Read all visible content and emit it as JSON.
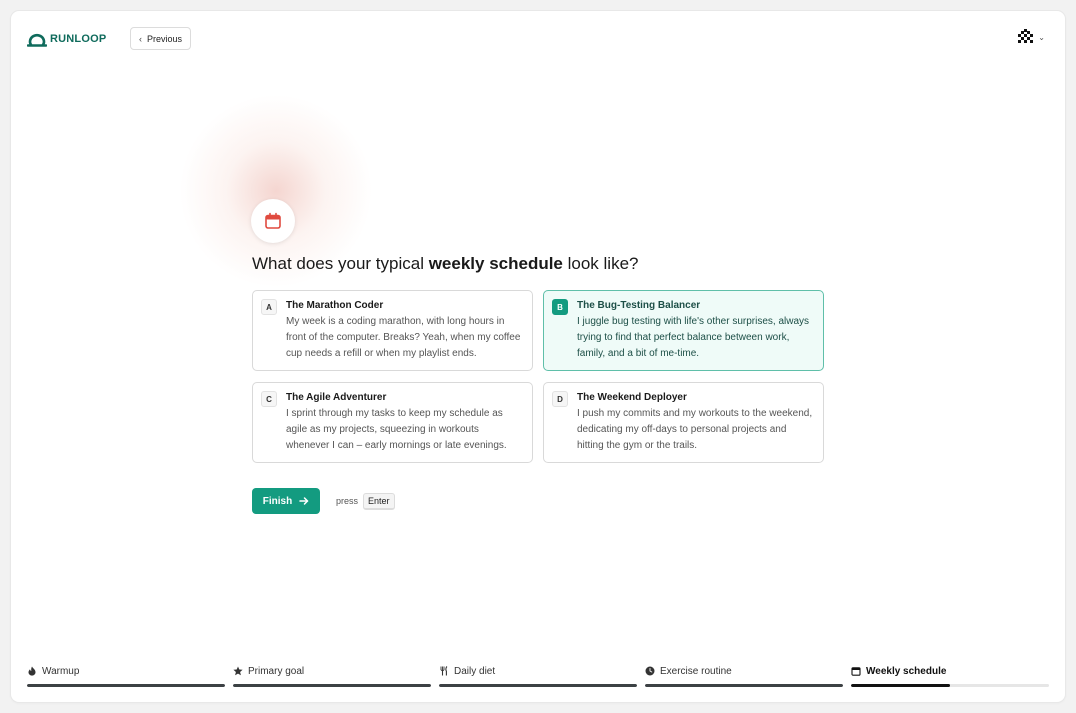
{
  "header": {
    "logo_text": "RUNLOOP",
    "previous_label": "Previous"
  },
  "question": {
    "prefix": "What does your typical ",
    "emphasis": "weekly schedule",
    "suffix": " look like?"
  },
  "options": [
    {
      "key": "A",
      "title": "The Marathon Coder",
      "description": "My week is a coding marathon, with long hours in front of the computer. Breaks? Yeah, when my coffee cup needs a refill or when my playlist ends.",
      "selected": false
    },
    {
      "key": "B",
      "title": "The Bug-Testing Balancer",
      "description": "I juggle bug testing with life's other surprises, always trying to find that perfect balance between work, family, and a bit of me-time.",
      "selected": true
    },
    {
      "key": "C",
      "title": "The Agile Adventurer",
      "description": "I sprint through my tasks to keep my schedule as agile as my projects, squeezing in workouts whenever I can – early mornings or late evenings.",
      "selected": false
    },
    {
      "key": "D",
      "title": "The Weekend Deployer",
      "description": "I push my commits and my workouts to the weekend, dedicating my off-days to personal projects and hitting the gym or the trails.",
      "selected": false
    }
  ],
  "finish": {
    "label": "Finish",
    "hint_prefix": "press",
    "hint_key": "Enter"
  },
  "progress": [
    {
      "label": "Warmup",
      "icon": "flame-icon",
      "progress": 1.0,
      "active": false
    },
    {
      "label": "Primary goal",
      "icon": "star-icon",
      "progress": 1.0,
      "active": false
    },
    {
      "label": "Daily diet",
      "icon": "utensils-icon",
      "progress": 1.0,
      "active": false
    },
    {
      "label": "Exercise routine",
      "icon": "clock-icon",
      "progress": 1.0,
      "active": false
    },
    {
      "label": "Weekly schedule",
      "icon": "calendar-icon",
      "progress": 0.5,
      "active": true
    }
  ],
  "colors": {
    "brand": "#0f6b5c",
    "accent": "#139b80",
    "selected_bg": "#effbf8",
    "calendar_icon": "#e04a3f"
  }
}
